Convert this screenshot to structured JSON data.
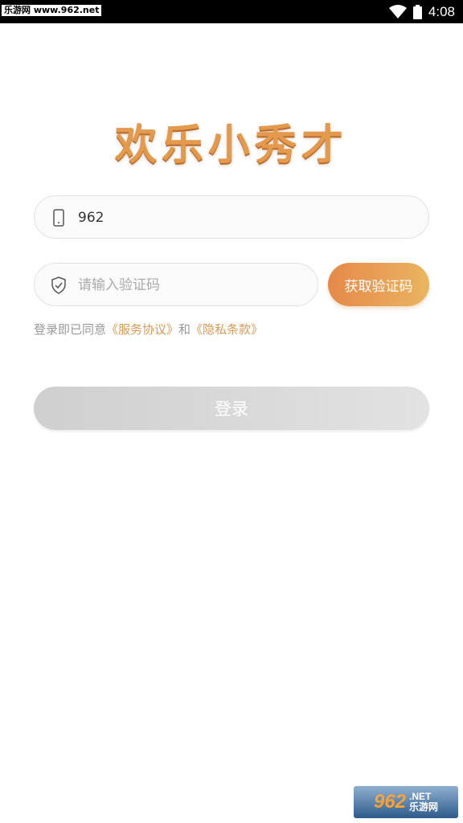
{
  "status_bar": {
    "watermark": "乐游网 www.962.net",
    "time": "4:08",
    "icons": [
      "wifi-icon",
      "battery-icon"
    ]
  },
  "brand": {
    "title": "欢乐小秀才"
  },
  "form": {
    "phone_value": "962",
    "code_placeholder": "请输入验证码",
    "get_code_label": "获取验证码",
    "agree_prefix": "登录即已同意",
    "service_link": "《服务协议》",
    "agree_and": "和",
    "privacy_link": "《隐私条款》",
    "login_label": "登录"
  },
  "watermark": {
    "number": "962",
    "net": ".NET",
    "site": "乐游网"
  },
  "colors": {
    "accent_start": "#E6894A",
    "accent_end": "#E9B560",
    "link": "#D89A55",
    "button_disabled": "#D6D6D6"
  }
}
